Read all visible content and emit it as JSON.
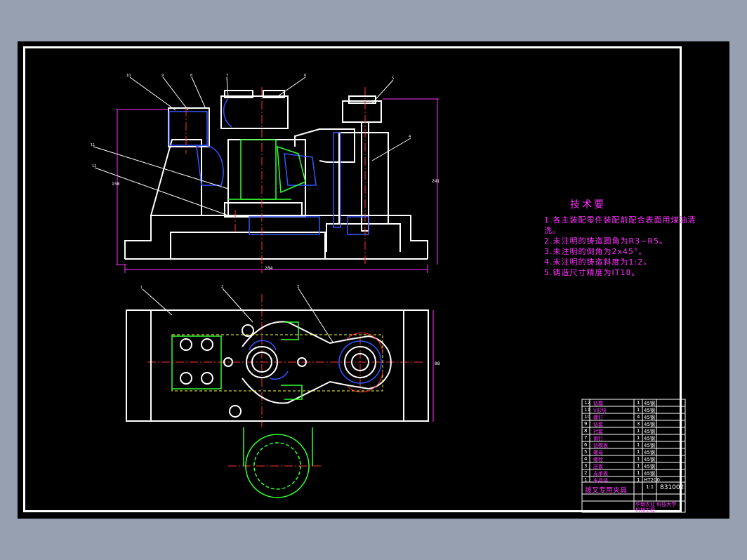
{
  "technical_requirements": {
    "title": "技术要",
    "items": [
      "1.各主装配零件装配前配合表面用煤油清",
      "洗。",
      "2.未注明的铸造圆角为R3~R5。",
      "3.未注明的倒角为2x45°。",
      "4.未注明的铸造斜度为1:2。",
      "5.铸造尺寸精度为IT18。"
    ]
  },
  "title_block": {
    "drawing_name": "拨叉专用夹具",
    "drawing_number": "831002",
    "scale": "1:1",
    "school": "华南农业 科技大学",
    "dept": "机械工程",
    "rows": [
      {
        "no": "12",
        "name": "钻模",
        "qty": "1",
        "mat": "45钢"
      },
      {
        "no": "11",
        "name": "V形块",
        "qty": "1",
        "mat": "45钢"
      },
      {
        "no": "10",
        "name": "螺钉",
        "qty": "4",
        "mat": "45钢"
      },
      {
        "no": "9",
        "name": "钻套",
        "qty": "3",
        "mat": "45钢"
      },
      {
        "no": "8",
        "name": "衬套",
        "qty": "1",
        "mat": "45钢"
      },
      {
        "no": "7",
        "name": "销钉",
        "qty": "1",
        "mat": "45钢"
      },
      {
        "no": "6",
        "name": "钻模板",
        "qty": "1",
        "mat": "45钢"
      },
      {
        "no": "5",
        "name": "螺母",
        "qty": "1",
        "mat": "45钢"
      },
      {
        "no": "4",
        "name": "螺栓",
        "qty": "1",
        "mat": "45钢"
      },
      {
        "no": "3",
        "name": "压板",
        "qty": "1",
        "mat": "45钢"
      },
      {
        "no": "2",
        "name": "支承板",
        "qty": "1",
        "mat": "45钢"
      },
      {
        "no": "1",
        "name": "夹具体",
        "qty": "1",
        "mat": "HT200"
      }
    ]
  },
  "dimensions": {
    "front_width": "284",
    "front_height_left": "158",
    "front_height_right": "241",
    "top_height": "88"
  },
  "part_labels": [
    "10",
    "9",
    "8",
    "7",
    "6",
    "5",
    "4",
    "11",
    "12",
    "1",
    "2",
    "3"
  ]
}
